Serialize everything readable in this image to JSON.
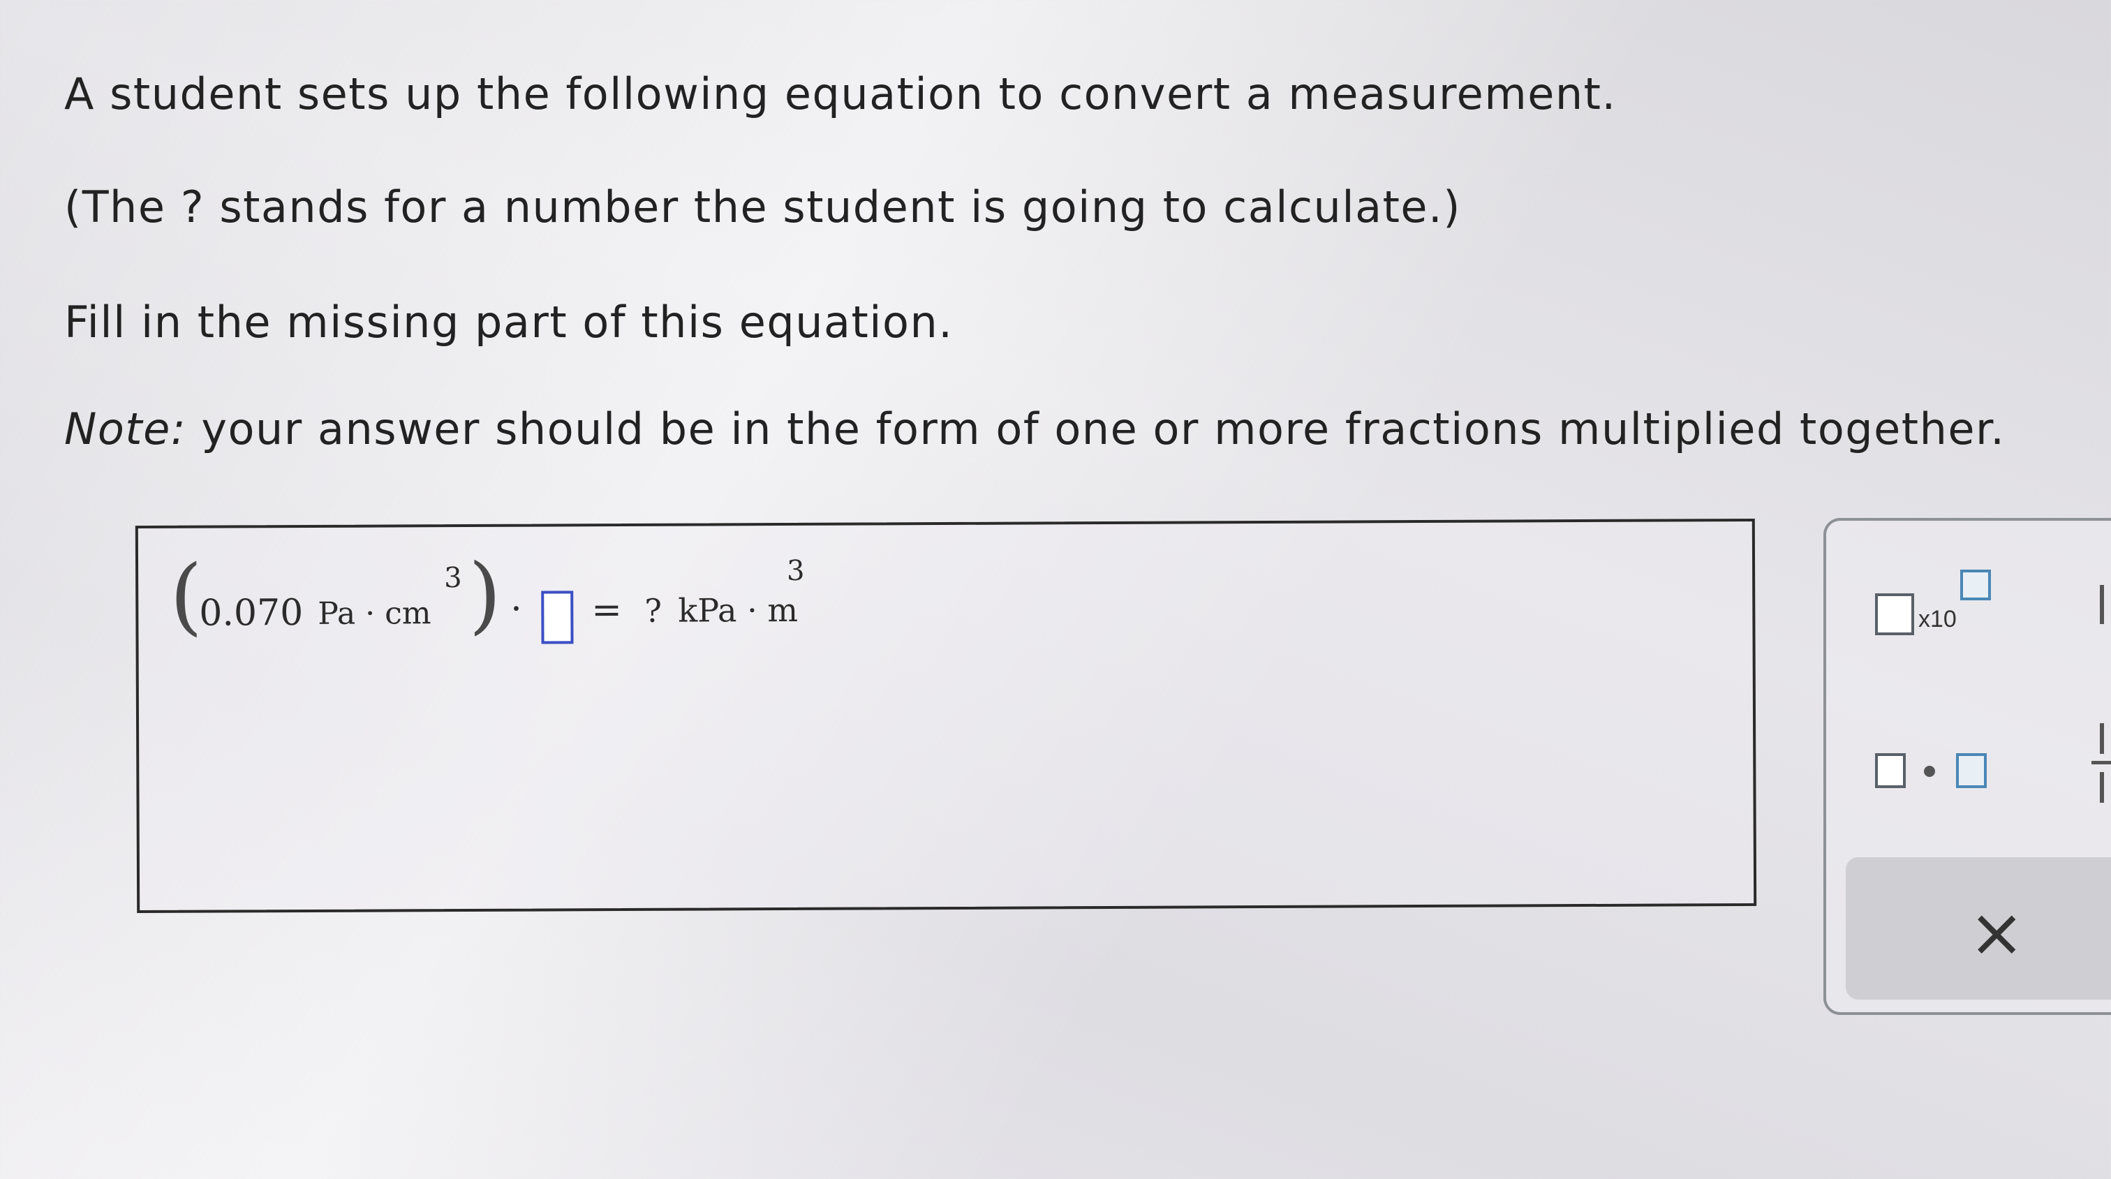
{
  "question": {
    "line1": "A student sets up the following equation to convert a measurement.",
    "line2": "(The ? stands for a number the student is going to calculate.)",
    "line3": "Fill in the missing part of this equation.",
    "note_label": "Note:",
    "note_text": " your answer should be in the form of one or more fractions multiplied together."
  },
  "equation": {
    "open_paren": "(",
    "quantity": "0.070",
    "unit1": "Pa · cm",
    "unit1_exp": "3",
    "close_paren": ")",
    "dot1": "·",
    "equals": "=",
    "unknown": "?",
    "unit2": "kPa · m",
    "unit2_exp": "3"
  },
  "tools": {
    "x10_label": "x10",
    "clear_symbol": "×"
  },
  "icons": {
    "sci_notation": "scientific-notation-icon",
    "multiply_dot": "multiplication-dot-icon",
    "clear": "close-icon"
  },
  "colors": {
    "blank_border": "#3b4fc4",
    "tool_square_accent": "#4a87b5"
  }
}
